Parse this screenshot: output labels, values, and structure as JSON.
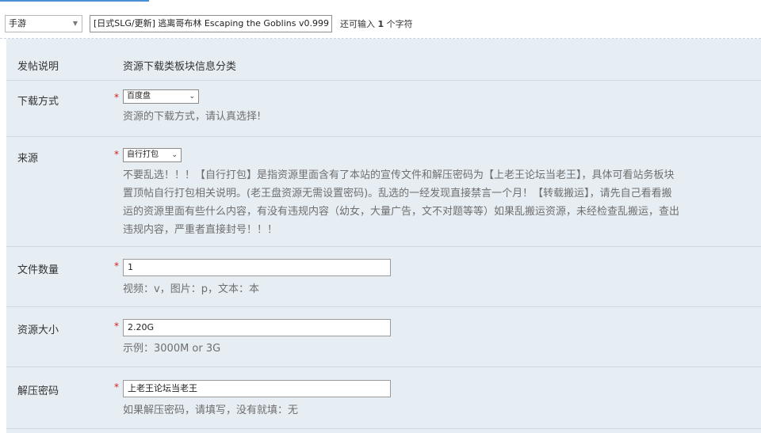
{
  "topbar": {
    "type_select_value": "手游",
    "title_value": "[日式SLG/更新] 逃离哥布林 Escaping the Goblins v0.999",
    "char_hint_prefix": "还可输入",
    "char_hint_count": "1",
    "char_hint_suffix": "个字符"
  },
  "form": {
    "post_note": {
      "label": "发帖说明",
      "value": "资源下载类板块信息分类"
    },
    "download_method": {
      "label": "下载方式",
      "required_mark": "*",
      "selected": "百度盘",
      "hint": "资源的下载方式，请认真选择!"
    },
    "source": {
      "label": "来源",
      "required_mark": "*",
      "selected": "自行打包",
      "hint_lines": [
        "不要乱选！！！【自行打包】是指资源里面含有了本站的宣传文件和解压密码为【上老王论坛当老王】，具体可看站务板块",
        "置顶帖自行打包相关说明。(老王盘资源无需设置密码)。乱选的一经发现直接禁言一个月！【转载搬运】，请先自己看看搬",
        "运的资源里面有些什么内容，有没有违规内容（幼女，大量广告，文不对题等等）如果乱搬运资源，未经检查乱搬运，查出",
        "违规内容，严重者直接封号！！！"
      ]
    },
    "file_count": {
      "label": "文件数量",
      "required_mark": "*",
      "value": "1",
      "hint": "视频：v，图片：p，文本：本"
    },
    "resource_size": {
      "label": "资源大小",
      "required_mark": "*",
      "value": "2.20G",
      "hint": "示例：3000M or 3G"
    },
    "unzip_password": {
      "label": "解压密码",
      "required_mark": "*",
      "value": "上老王论坛当老王",
      "hint": "如果解压密码，请填写，没有就填：无"
    }
  },
  "colors": {
    "form_background": "#e6edf3",
    "required": "#d02020",
    "accent": "#4a8fd6"
  }
}
